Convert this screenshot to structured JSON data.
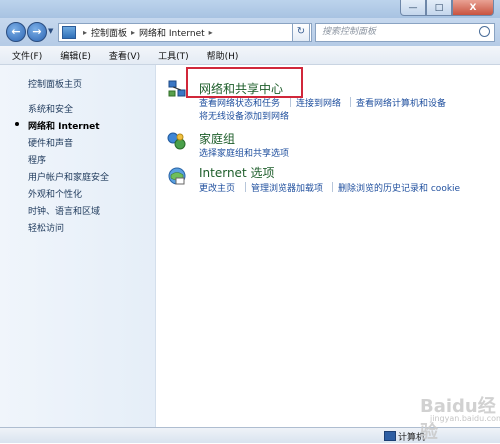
{
  "titlebar": {
    "ghost_title": "",
    "buttons": {
      "minimize": "—",
      "maximize": "□",
      "close": "X"
    }
  },
  "address": {
    "back_label": "←",
    "forward_label": "→",
    "crumbs": [
      "控制面板",
      "网络和 Internet"
    ],
    "search_placeholder": "搜索控制面板",
    "refresh_label": "↻"
  },
  "menubar": {
    "items": [
      "文件(F)",
      "编辑(E)",
      "查看(V)",
      "工具(T)",
      "帮助(H)"
    ]
  },
  "sidebar": {
    "items": [
      {
        "label": "控制面板主页"
      },
      {
        "label": "系统和安全"
      },
      {
        "label": "网络和 Internet"
      },
      {
        "label": "硬件和声音"
      },
      {
        "label": "程序"
      },
      {
        "label": "用户帐户和家庭安全"
      },
      {
        "label": "外观和个性化"
      },
      {
        "label": "时钟、语言和区域"
      },
      {
        "label": "轻松访问"
      }
    ]
  },
  "main": {
    "categories": [
      {
        "title": "网络和共享中心",
        "icon": "network-sharing-icon",
        "tasks": [
          "查看网络状态和任务",
          "连接到网络",
          "查看网络计算机和设备",
          "将无线设备添加到网络"
        ]
      },
      {
        "title": "家庭组",
        "icon": "homegroup-icon",
        "tasks": [
          "选择家庭组和共享选项"
        ]
      },
      {
        "title": "Internet 选项",
        "icon": "internet-options-icon",
        "tasks": [
          "更改主页",
          "管理浏览器加载项",
          "删除浏览的历史记录和 cookie"
        ]
      }
    ]
  },
  "statusbar": {
    "text": "计算机"
  },
  "watermark": {
    "text": "Baidu经验",
    "sub": "jingyan.baidu.com"
  },
  "colors": {
    "highlight": "#d1273a",
    "link": "#1f4f9e",
    "category": "#1d5d2a"
  }
}
